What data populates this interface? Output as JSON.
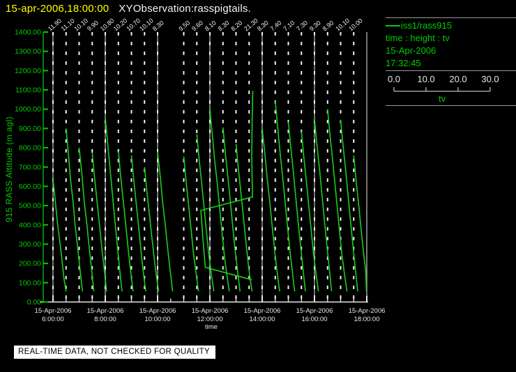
{
  "header": {
    "timestamp": "15-apr-2006,18:00:00",
    "title": "XYObservation:rasspigtails."
  },
  "legend": {
    "series": "iss1/rass915",
    "relation": "time : height : tv",
    "date": "15-Apr-2006",
    "time": "17:32:45",
    "scale": {
      "ticks": [
        "0.0",
        "10.0",
        "20.0",
        "30.0"
      ],
      "label": "tv",
      "min": 0.0,
      "max": 30.0
    }
  },
  "banner": {
    "text": "REAL-TIME DATA, NOT CHECKED FOR QUALITY"
  },
  "colors": {
    "background": "#000000",
    "timestamp_yellow": "#ffff00",
    "title_white": "#f5f5f5",
    "axis_green": "#00cd00",
    "trace_green": "#19cf19",
    "gridline_gray": "#a9a9a9",
    "profile_dash_white": "#f2f2f2",
    "axis_text_white": "#e8e8e8"
  },
  "chart_data": {
    "type": "line",
    "title": "XYObservation:rasspigtails.",
    "ylabel": "915 RASS Altitude (m agl)",
    "xlabel": "time",
    "ylim": [
      0,
      1400
    ],
    "x_range_hours": [
      6,
      18
    ],
    "grid": "vertical-2h-solid-plus-30min-dashed-profile-lines",
    "legend_position": "right",
    "y_ticks": [
      {
        "v": 0,
        "label": "0.00"
      },
      {
        "v": 100,
        "label": "100.00"
      },
      {
        "v": 200,
        "label": "200.00"
      },
      {
        "v": 300,
        "label": "300.00"
      },
      {
        "v": 400,
        "label": "400.00"
      },
      {
        "v": 500,
        "label": "500.00"
      },
      {
        "v": 600,
        "label": "600.00"
      },
      {
        "v": 700,
        "label": "700.00"
      },
      {
        "v": 800,
        "label": "800.00"
      },
      {
        "v": 900,
        "label": "900.00"
      },
      {
        "v": 1000,
        "label": "1000.00"
      },
      {
        "v": 1100,
        "label": "1100.00"
      },
      {
        "v": 1200,
        "label": "1200.00"
      },
      {
        "v": 1300,
        "label": "1300.00"
      },
      {
        "v": 1400,
        "label": "1400.00"
      }
    ],
    "x_ticks": [
      {
        "hour": 6,
        "date": "15-Apr-2006",
        "time": "6:00:00"
      },
      {
        "hour": 8,
        "date": "15-Apr-2006",
        "time": "8:00:00"
      },
      {
        "hour": 10,
        "date": "15-Apr-2006",
        "time": "10:00:00"
      },
      {
        "hour": 12,
        "date": "15-Apr-2006",
        "time": "12:00:00"
      },
      {
        "hour": 14,
        "date": "15-Apr-2006",
        "time": "14:00:00"
      },
      {
        "hour": 16,
        "date": "15-Apr-2006",
        "time": "16:00:00"
      },
      {
        "hour": 18,
        "date": "15-Apr-2006",
        "time": "18:00:00"
      }
    ],
    "profiles": [
      {
        "hour": 6.0,
        "tv_label": "11.90",
        "points": [
          [
            640,
            11.9
          ],
          [
            520,
            12.6
          ],
          [
            400,
            13.3
          ],
          [
            290,
            14.1
          ],
          [
            200,
            14.7
          ],
          [
            120,
            15.2
          ],
          [
            55,
            15.8
          ]
        ]
      },
      {
        "hour": 6.5,
        "tv_label": "11.10",
        "points": [
          [
            900,
            11.1
          ],
          [
            770,
            11.8
          ],
          [
            640,
            12.4
          ],
          [
            520,
            13.2
          ],
          [
            400,
            13.8
          ],
          [
            290,
            14.5
          ],
          [
            180,
            15.2
          ],
          [
            55,
            16.0
          ]
        ]
      },
      {
        "hour": 7.0,
        "tv_label": "10.10",
        "points": [
          [
            800,
            10.1
          ],
          [
            670,
            10.9
          ],
          [
            540,
            11.5
          ],
          [
            420,
            12.3
          ],
          [
            300,
            13.0
          ],
          [
            190,
            13.7
          ],
          [
            55,
            14.5
          ]
        ]
      },
      {
        "hour": 7.5,
        "tv_label": "9.90",
        "points": [
          [
            775,
            9.9
          ],
          [
            645,
            10.6
          ],
          [
            515,
            11.4
          ],
          [
            395,
            12.1
          ],
          [
            275,
            12.8
          ],
          [
            170,
            13.5
          ],
          [
            55,
            14.2
          ]
        ]
      },
      {
        "hour": 8.0,
        "tv_label": "10.80",
        "points": [
          [
            955,
            10.8
          ],
          [
            825,
            11.5
          ],
          [
            695,
            12.2
          ],
          [
            565,
            12.9
          ],
          [
            435,
            13.6
          ],
          [
            305,
            14.3
          ],
          [
            185,
            15.0
          ],
          [
            55,
            15.8
          ]
        ]
      },
      {
        "hour": 8.5,
        "tv_label": "10.20",
        "points": [
          [
            780,
            10.2
          ],
          [
            650,
            10.9
          ],
          [
            520,
            11.7
          ],
          [
            400,
            12.4
          ],
          [
            280,
            13.1
          ],
          [
            170,
            13.8
          ],
          [
            55,
            14.6
          ]
        ]
      },
      {
        "hour": 9.0,
        "tv_label": "10.70",
        "points": [
          [
            760,
            10.7
          ],
          [
            630,
            11.4
          ],
          [
            500,
            12.2
          ],
          [
            380,
            12.9
          ],
          [
            260,
            13.6
          ],
          [
            160,
            14.2
          ],
          [
            55,
            15.0
          ]
        ]
      },
      {
        "hour": 9.5,
        "tv_label": "10.10",
        "points": [
          [
            700,
            10.1
          ],
          [
            575,
            10.8
          ],
          [
            450,
            11.6
          ],
          [
            335,
            12.3
          ],
          [
            225,
            13.0
          ],
          [
            140,
            13.6
          ],
          [
            55,
            14.3
          ]
        ]
      },
      {
        "hour": 10.0,
        "tv_label": "8.30",
        "points": [
          [
            780,
            8.3
          ],
          [
            650,
            9.1
          ],
          [
            520,
            9.8
          ],
          [
            400,
            10.6
          ],
          [
            280,
            11.3
          ],
          [
            170,
            12.0
          ],
          [
            55,
            12.8
          ]
        ]
      },
      {
        "hour": 11.0,
        "tv_label": "9.50",
        "points": [
          [
            755,
            9.5
          ],
          [
            625,
            10.2
          ],
          [
            495,
            11.0
          ],
          [
            375,
            11.7
          ],
          [
            255,
            12.4
          ],
          [
            160,
            13.1
          ],
          [
            55,
            13.9
          ]
        ]
      },
      {
        "hour": 11.5,
        "tv_label": "9.60",
        "points": [
          [
            870,
            9.6
          ],
          [
            740,
            10.3
          ],
          [
            610,
            11.1
          ],
          [
            485,
            11.8
          ],
          [
            360,
            12.5
          ],
          [
            245,
            13.2
          ],
          [
            150,
            13.9
          ],
          [
            55,
            14.7
          ]
        ]
      },
      {
        "hour": 12.0,
        "tv_label": "8.10",
        "points": [
          [
            1000,
            8.1
          ],
          [
            870,
            8.8
          ],
          [
            740,
            9.5
          ],
          [
            615,
            10.3
          ],
          [
            490,
            11.0
          ],
          [
            365,
            11.7
          ],
          [
            245,
            12.4
          ],
          [
            150,
            13.1
          ],
          [
            55,
            13.9
          ]
        ]
      },
      {
        "hour": 12.5,
        "tv_label": "8.30",
        "points": [
          [
            905,
            8.3
          ],
          [
            775,
            9.0
          ],
          [
            645,
            9.8
          ],
          [
            520,
            10.5
          ],
          [
            395,
            11.2
          ],
          [
            275,
            11.9
          ],
          [
            170,
            12.6
          ],
          [
            55,
            13.4
          ]
        ]
      },
      {
        "hour": 13.0,
        "tv_label": "8.20",
        "points": [
          [
            820,
            8.2
          ],
          [
            690,
            8.9
          ],
          [
            560,
            9.7
          ],
          [
            440,
            10.4
          ],
          [
            320,
            11.1
          ],
          [
            205,
            11.8
          ],
          [
            120,
            12.4
          ],
          [
            55,
            13.0
          ]
        ]
      },
      {
        "hour": 13.5,
        "tv_label": "21.30",
        "points": [
          [
            1095,
            22.4
          ],
          [
            930,
            22.2
          ],
          [
            760,
            22.1
          ],
          [
            640,
            22.2
          ],
          [
            545,
            22.3
          ],
          [
            475,
            6.9
          ],
          [
            330,
            7.5
          ],
          [
            180,
            8.2
          ],
          [
            115,
            22.1
          ]
        ]
      },
      {
        "hour": 14.0,
        "tv_label": "8.30",
        "points": [
          [
            900,
            8.3
          ],
          [
            770,
            9.1
          ],
          [
            640,
            9.8
          ],
          [
            515,
            10.6
          ],
          [
            390,
            11.3
          ],
          [
            270,
            12.0
          ],
          [
            165,
            12.7
          ],
          [
            55,
            13.5
          ]
        ]
      },
      {
        "hour": 14.5,
        "tv_label": "7.40",
        "points": [
          [
            1040,
            7.4
          ],
          [
            910,
            8.1
          ],
          [
            780,
            8.8
          ],
          [
            650,
            9.6
          ],
          [
            525,
            10.3
          ],
          [
            400,
            11.0
          ],
          [
            280,
            11.7
          ],
          [
            170,
            12.4
          ],
          [
            55,
            13.2
          ]
        ]
      },
      {
        "hour": 15.0,
        "tv_label": "7.10",
        "points": [
          [
            935,
            7.1
          ],
          [
            805,
            7.8
          ],
          [
            675,
            8.6
          ],
          [
            545,
            9.3
          ],
          [
            420,
            10.0
          ],
          [
            300,
            10.7
          ],
          [
            185,
            11.4
          ],
          [
            55,
            12.2
          ]
        ]
      },
      {
        "hour": 15.5,
        "tv_label": "7.30",
        "points": [
          [
            885,
            7.3
          ],
          [
            755,
            8.0
          ],
          [
            625,
            8.8
          ],
          [
            500,
            9.5
          ],
          [
            375,
            10.2
          ],
          [
            255,
            10.9
          ],
          [
            155,
            11.6
          ],
          [
            55,
            12.4
          ]
        ]
      },
      {
        "hour": 16.0,
        "tv_label": "9.30",
        "points": [
          [
            950,
            9.3
          ],
          [
            820,
            10.0
          ],
          [
            690,
            10.8
          ],
          [
            560,
            11.5
          ],
          [
            435,
            12.2
          ],
          [
            310,
            12.9
          ],
          [
            195,
            13.6
          ],
          [
            55,
            14.4
          ]
        ]
      },
      {
        "hour": 16.5,
        "tv_label": "8.90",
        "points": [
          [
            1000,
            8.9
          ],
          [
            870,
            9.6
          ],
          [
            740,
            10.4
          ],
          [
            615,
            11.1
          ],
          [
            490,
            11.8
          ],
          [
            365,
            12.5
          ],
          [
            245,
            13.2
          ],
          [
            150,
            13.9
          ],
          [
            55,
            14.7
          ]
        ]
      },
      {
        "hour": 17.0,
        "tv_label": "10.10",
        "points": [
          [
            945,
            10.1
          ],
          [
            815,
            10.8
          ],
          [
            685,
            11.6
          ],
          [
            555,
            12.3
          ],
          [
            430,
            13.0
          ],
          [
            305,
            13.7
          ],
          [
            190,
            14.4
          ],
          [
            55,
            15.2
          ]
        ]
      },
      {
        "hour": 17.5,
        "tv_label": "10.00",
        "points": [
          [
            760,
            10.0
          ],
          [
            630,
            10.7
          ],
          [
            500,
            11.5
          ],
          [
            380,
            12.2
          ],
          [
            260,
            12.9
          ],
          [
            160,
            13.6
          ],
          [
            55,
            13.8
          ]
        ]
      }
    ]
  }
}
